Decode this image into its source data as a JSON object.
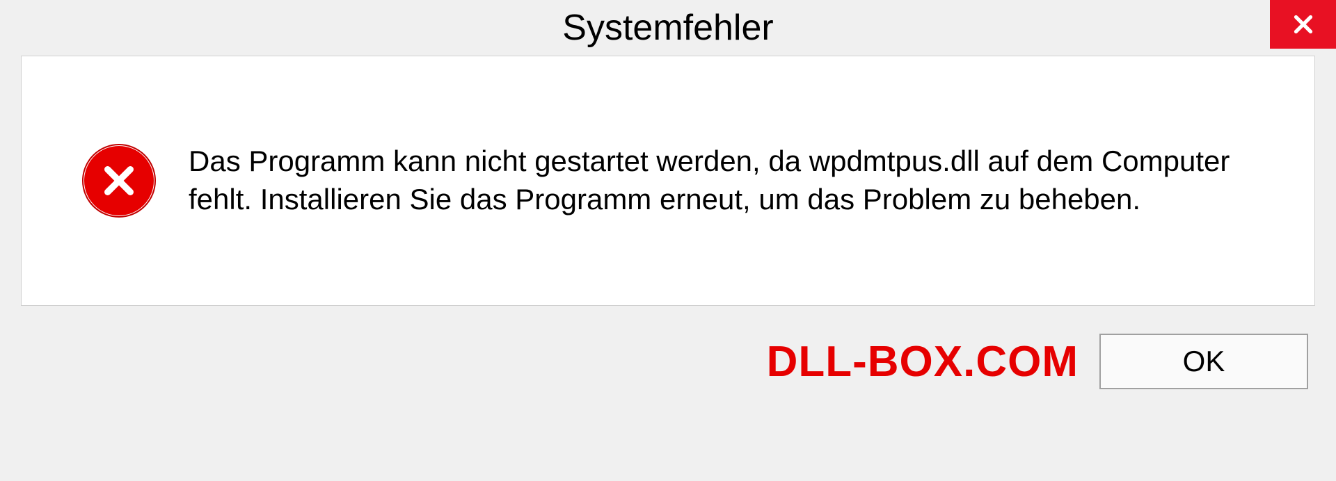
{
  "dialog": {
    "title": "Systemfehler",
    "message": "Das Programm kann nicht gestartet werden, da wpdmtpus.dll auf dem Computer fehlt. Installieren Sie das Programm erneut, um das Problem zu beheben.",
    "ok_label": "OK"
  },
  "watermark": "DLL-BOX.COM"
}
